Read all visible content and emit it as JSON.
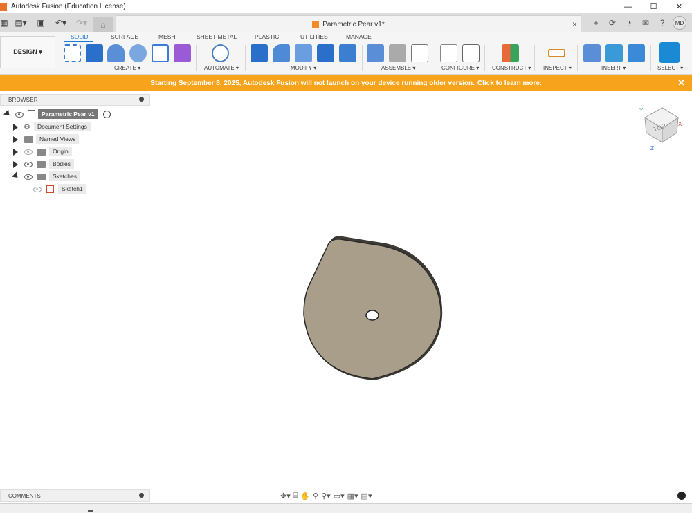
{
  "titlebar": {
    "title": "Autodesk Fusion (Education License)",
    "min": "—",
    "max": "☐",
    "close": "✕"
  },
  "tabstrip": {
    "doc_title": "Parametric Pear v1*",
    "close": "×",
    "avatar": "MD"
  },
  "toolbar": {
    "workspace": "DESIGN ▾",
    "tabs": [
      "SOLID",
      "SURFACE",
      "MESH",
      "SHEET METAL",
      "PLASTIC",
      "UTILITIES",
      "MANAGE"
    ],
    "groups": [
      "CREATE ▾",
      "AUTOMATE ▾",
      "MODIFY ▾",
      "ASSEMBLE ▾",
      "CONFIGURE ▾",
      "CONSTRUCT ▾",
      "INSPECT ▾",
      "INSERT ▾",
      "SELECT ▾"
    ]
  },
  "banner": {
    "text": "Starting September 8, 2025, Autodesk Fusion will not launch on your device running older version.",
    "link": "Click to learn more.",
    "close": "✕"
  },
  "browser": {
    "header": "BROWSER",
    "root": "Parametric Pear v1",
    "items": [
      "Document Settings",
      "Named Views",
      "Origin",
      "Bodies",
      "Sketches",
      "Sketch1"
    ]
  },
  "viewcube": {
    "face": "TOP",
    "x": "X",
    "y": "Y",
    "z": "Z"
  },
  "comments": {
    "header": "COMMENTS"
  },
  "colors": {
    "accent": "#1a7ad4",
    "banner": "#f7a41c",
    "body": "#a89e8a"
  }
}
